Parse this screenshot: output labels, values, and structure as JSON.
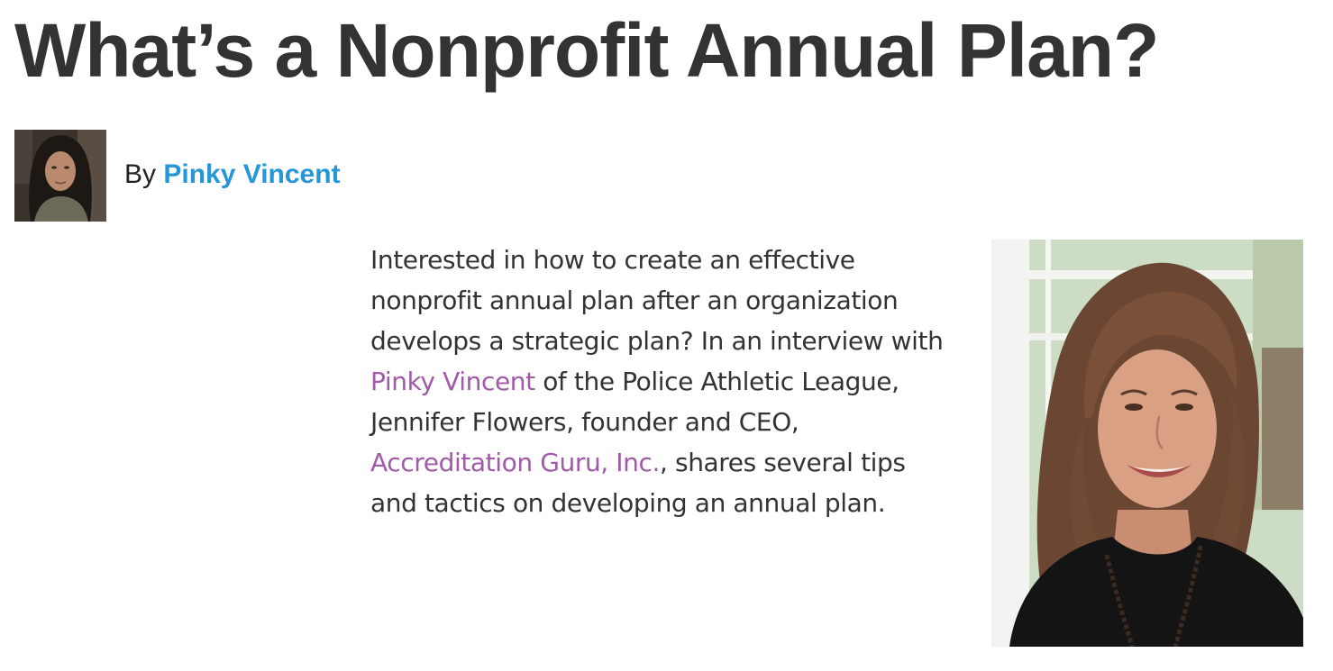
{
  "article": {
    "title": "What’s a Nonprofit Annual Plan?",
    "byline_prefix": "By",
    "author_name": "Pinky Vincent"
  },
  "intro": {
    "lines": [
      "Interested in how to create an effective",
      "nonprofit annual plan after an organization",
      "develops a strategic plan? In an interview with"
    ],
    "link1": "Pinky Vincent",
    "line4_rest": " of the Police Athletic League,",
    "line5": "Jennifer Flowers, founder and CEO,",
    "link2": "Accreditation Guru, Inc.",
    "line6_rest": ", shares several tips",
    "line7": "and tactics on developing an annual plan."
  },
  "colors": {
    "title": "#333333",
    "author_link": "#2596d6",
    "body_link": "#a05aa8"
  },
  "images": {
    "avatar_icon": "author-avatar-photo",
    "photo_icon": "interviewee-portrait-photo"
  }
}
